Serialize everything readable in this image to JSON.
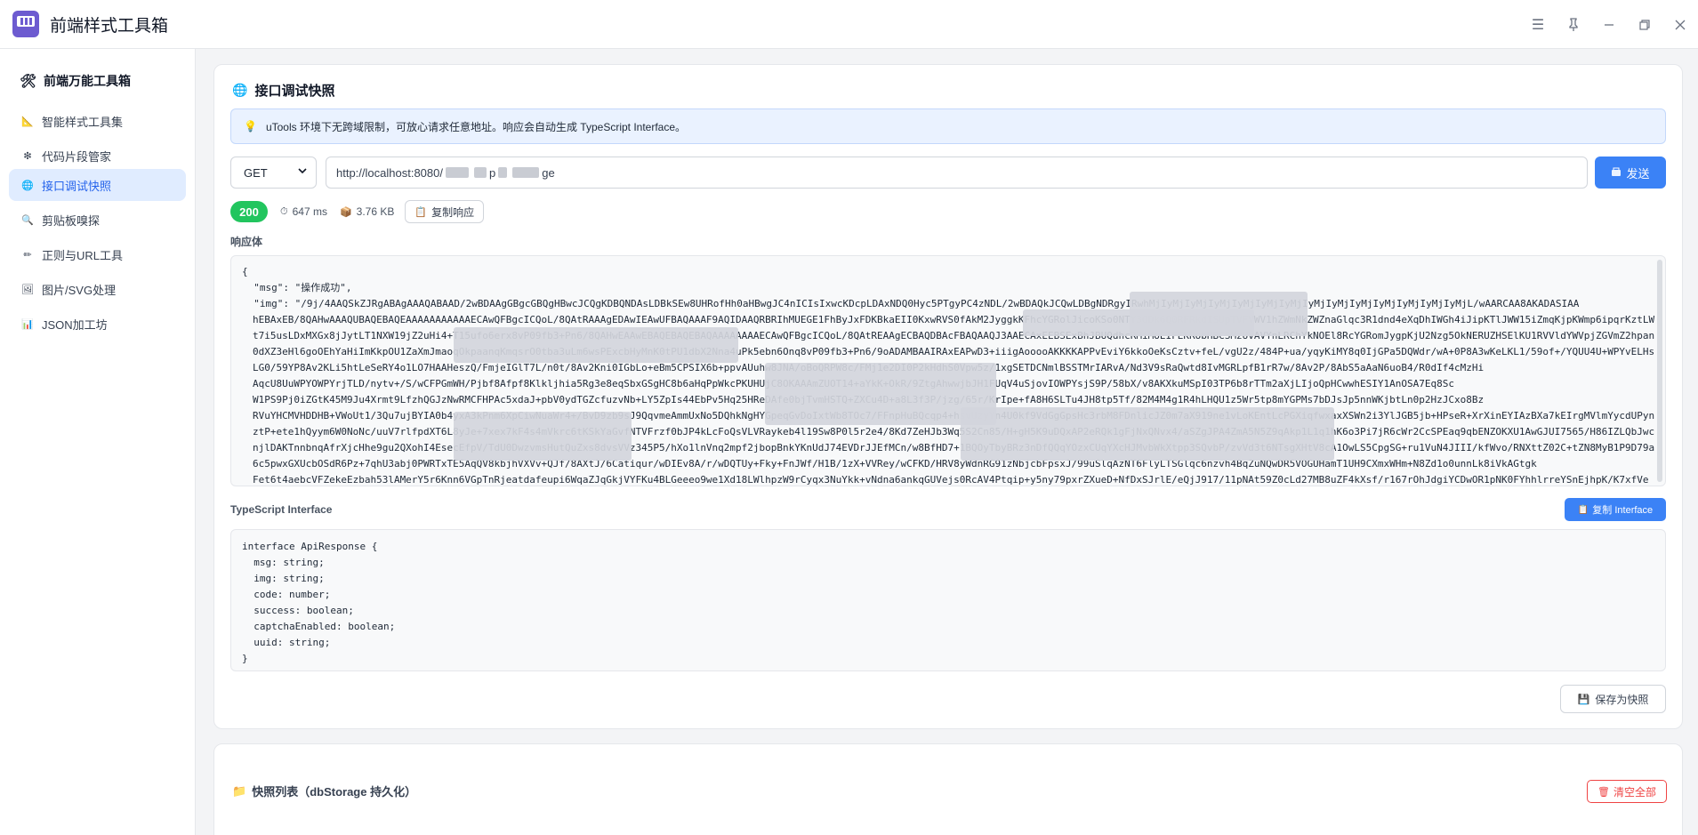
{
  "window": {
    "title": "前端样式工具箱",
    "controls": [
      "menu-icon",
      "pin-icon",
      "minimize-icon",
      "restore-icon",
      "close-icon"
    ]
  },
  "sidebar": {
    "brand": "前端万能工具箱",
    "items": [
      {
        "label": "智能样式工具集",
        "icon": "ruler-icon",
        "active": false
      },
      {
        "label": "代码片段管家",
        "icon": "sparkle-icon",
        "active": false
      },
      {
        "label": "接口调试快照",
        "icon": "globe-icon",
        "active": true
      },
      {
        "label": "剪贴板嗅探",
        "icon": "magnifier-icon",
        "active": false
      },
      {
        "label": "正则与URL工具",
        "icon": "pen-icon",
        "active": false
      },
      {
        "label": "图片/SVG处理",
        "icon": "image-icon",
        "active": false
      },
      {
        "label": "JSON加工坊",
        "icon": "bar-chart-icon",
        "active": false
      }
    ]
  },
  "main": {
    "title": "接口调试快照",
    "alert": "uTools 环境下无跨域限制，可放心请求任意地址。响应会自动生成 TypeScript Interface。",
    "method": "GET",
    "url_prefix": "http://localhost:8080/",
    "url_mid": "p",
    "url_suffix": "ge",
    "send_label": "发送",
    "status_code": "200",
    "duration": "647 ms",
    "size": "3.76 KB",
    "copy_response_label": "复制响应",
    "response_label": "响应体",
    "response_lines": [
      "{",
      "  \"msg\": \"操作成功\",",
      "  \"img\": \"/9j/4AAQSkZJRgABAgAAAQABAAD/2wBDAAgGBgcGBQgHBwcJCQgKDBQNDAsLDBkSEw8UHRofHh0aHBwgJC4nICIsIxwcKDcpLDAxNDQ0Hyc5PTgyPC4zNDL/2wBDAQkJCQwLDBgNDRgyIRwhMjIyMjIyMjIyMjIyMjIyMjIyMjIyMjIyMjIyMjIyMjIyMjIyMjIyMjL/wAARCAA8AKADASIAA"
    ],
    "response_wrapped": [
      "hEBAxEB/8QAHwAAAQUBAQEBAQEAAAAAAAAAAAECAwQFBgcICQoL/8QAtRAAAgEDAwIEAwUFBAQAAAF9AQIDAAQRBRIhMUEGE1FhByJxFDKBkaEII0KxwRVS0fAkM2JyggkKFhcYGRolJicoKSo0NTY3ODk6Q0RFRkdISUpTVFVWV1hZWmNkZWZnaGlqc3R1dnd4eXqDhIWGh4iJipKTlJWW15iZmqKjpKWmp6ipqrKztLW2",
      "t7i5usLDxMXGx8jJytLT1NXW19jZ2uHi4+T15ufo6erx8vP09fb3+Pn6/8QAHwEAAwEBAQEBAQEBAQAAAAAAAAECAwQFBgcICQoL/8QAtREAAgECBAQDBAcFBAQAAQJ3AAECAxEEBSExBhJBUQdhcRMiMoEIFEKRobHBCSMzUvAVYnLRChYkNOEl8RcYGRomJygpKjU2Nzg5OkNERUZHSElKU1RVVldYWVpjZGVmZ2hpanN",
      "0dXZ3eHl6goOEhYaHiImKkpOU1ZaXmJmaoqOkpaanqKmqsrO0tba3uLm6wsPExcbHyMnK0tPU1dbX2Nna4uPk5ebn6Onq8vP09fb3+Pn6/9oADAMBAAIRAxEAPwD3+iiigAooooAKKKKAPPvEviY6kkoOeKsCztv+feL/vgU2z/484P+ua/yqyKiMY8q0IjGPa5DQWdr/wA+0P8A3wKeLKL1/59of+/YQUU4U+WPYvELHsRCytP+fwH/v2",
      "LG0/59YP8Av2KLi5htLeSeRY4o1LO7HAAHeszQ/FmjeIGlT7L/n0t/8Av2Kni0IGbLo+eBm5CPSIX6b+ppvAUuhw8JNA/oBoQRPW8c/FMj1e2DI0P2kHdhS0Vpw5z/1xgSETDCNmlBSSTMrIARvA/Nd3V9sRaQwtd8IvMGRLpfB1rR7w/8Av2P/8AbS5aAaN6uoB4/R0dIf4cMzHi",
      "AqcU8UuWPYOWPYrjTLD/nytv+/S/wCFPGmWH/Pjbf8Afpf8Klkljhia5Rg3e8eqSbxGSgHC8b6aHqPpWkcPKUHUjC8OKAAAmZUOT14+aYkK+OkR/9ZtgAhwwjbJH1FUqV4uSjovIOWPYsjS9P/58bX/v8AKXkuMSpI03TP6b8rTTm2aXjLIjoQpHCwwhESIY1AnOSA7Eq8Sc",
      "W1PS9Pj0iZGtK45M9Ju4Xrmt9LfzhQGJzNwRMCFHPAc5xdaJ+pbV0ydTGZcfuzvNb+LY5ZpIs44EbPv5Hq25HReDAfe0bjTvmHSTQ+ZXCu4D+a8L3f3P/jzg/65r/KrIpe+fA8H6SLTu4JH8tp5Tf/82M4M4g1R4hLHQU1z5Wr5tp8mYGPMs7bDJsJp5nnWKjbtLn0p2HzJCxo8Bz",
      "RVuYHCMVHDDHB+VWoUt1/3Qu7ujBYIA0b4yxA3kPnm6XpCiwNuaWr4+/BvD9zb9sJ9QqvmeAmmUxNo5DQhkNgHYGpeqGvDoIxtWb8TOc7/FFnpHuBQcqp4+hsvUzyYn4U0kf9VdGgGpsHc3rbM8FDnlicJZ0m7aX919ne1vLoKEntLcPGXiqfwxaxXSWn2i3YlJGB5jb+HPseR+XrXinEYIAzBXa7kEIrgMVlmYycdUPynH0B/QV0V98RI9aMtrqmmmm2tpgQpyW4/2hgfmKJNGvCctsA",
      "ztP+ete1hQyym6W0NoNc/uuV7rlfpdXT6L8yJe+7xex7kF4s4mVkrc6tKSkYaGvfNTVFrzf0bJP4kLcFoQsVLVRaykeb4l19Sw8P0l5r2e4/8Kd7ZeHJb3Wq5S2Cn85/H+gH5K9uDQxAP2eRQk1gFjNxQNvx4/aSZgJPA4ZmA5N5Z9qAkp1L1q1hK6o3Pi7jR6cWr2CcSPEaq9qbENZOKXU1AwGJUI7565/H86IZLQbJwcZVHa94tJcvSSv8fTbptrowdR77HsHjG+i8QeGryx0nUbnZnkC7",
      "njlDAKTnnbnqAfrXjcHhe9gu2QXohI4EsecEfpV/TdU0DwzvmsHutQuZxs8dvsVVz345P5/hXo1lnVnq2mpf2jbopBnkYKnUdJ74EVDrJJEfMCn/w8BfHD7+1BQOyTbyBRz3nDfQQqYOzxCUqYXcHJMvbWkXtpp3SQvbP/zvVd3t6NTsgXHtV8cA1OwLS5CpgSG+ru1VuN4JIII/kfWvo/RNXttZ02C+tZN8MyB1P9D79a+ZvGtjwNaaE5SNH1OOHsEq3LWTq1sQ2yCp+vBq+pKeiK3bj1QLuDgqi3nKNK8QcvEt+Gz2Ihv",
      "6c5pwxGXUcbOSdR6Pz+7qhU3abj0PWRTxTE5AqQV8kbjhVXVv+QJf/8AXtJ/6Catiqur/wDIEv8A/r/wDQTUy+Fky+FnJWf/H1B/1zX+VVRey/wCFKD/HRV8yWdnRG91zNbjcbFpsxJ/99uSlqAzNT6FlyLTSGlqc6nzvh4BqZuNQwDR5VOGUHamT1UH9CXmxWHm+N8Zd1o0unnLk8iVkAGtgk",
      "Fet6t4aebcVFZekeEzbah53lAMerY5r6Knn6VGpTnRjeatdafeupi6WqaZJqGkjVYFKu4BLGeeeo9we1Xd18LWlhpzW9rCyqx3NuYkk+vNdna6ankqGUVejs0RcAV4Ptqip+y5ny79pxrZXueD+NfDxSJrlE/eQjJ917/11pNAt59Z0cLd27MB8uZF4kXsf/r167rOhJdgiYCDwOR1pNK0FYhhlrreYSnEjhpK/K7xfVe"
    ],
    "ts_label": "TypeScript Interface",
    "copy_interface_label": "复制 Interface",
    "ts_lines": [
      "interface ApiResponse {",
      "  msg: string;",
      "  img: string;",
      "  code: number;",
      "  success: boolean;",
      "  captchaEnabled: boolean;",
      "  uuid: string;",
      "}"
    ],
    "save_label": "保存为快照"
  },
  "snapshots": {
    "title": "快照列表（dbStorage 持久化）",
    "clear_label": "清空全部"
  },
  "colors": {
    "accent": "#3b82f6",
    "active_bg": "#e0ecff",
    "success": "#22c55e",
    "danger": "#ef4444"
  }
}
